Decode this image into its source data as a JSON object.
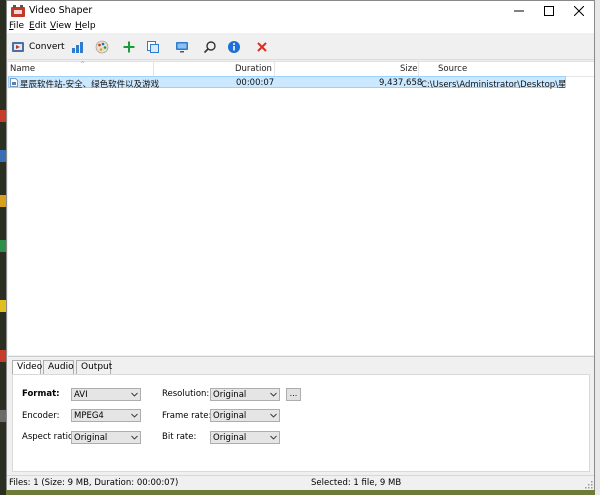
{
  "window": {
    "title": "Video Shaper",
    "controls": [
      "minimize",
      "maximize",
      "close"
    ]
  },
  "menu": {
    "items": [
      {
        "label": "File",
        "mnemonic": "F",
        "rest": "ile"
      },
      {
        "label": "Edit",
        "mnemonic": "E",
        "rest": "dit"
      },
      {
        "label": "View",
        "mnemonic": "V",
        "rest": "iew"
      },
      {
        "label": "Help",
        "mnemonic": "H",
        "rest": "elp"
      }
    ]
  },
  "toolbar": {
    "convert_label": "Convert",
    "icons": [
      "convert-icon",
      "chart-icon",
      "palette-icon",
      "add-icon",
      "copy-icon",
      "monitor-icon",
      "search-icon",
      "info-icon",
      "delete-icon"
    ],
    "colors": {
      "add": "#1a9c3a",
      "info": "#1e6fd9",
      "delete": "#d93025"
    }
  },
  "filelist": {
    "columns": [
      "Name",
      "Duration",
      "Size",
      "Source"
    ],
    "rows": [
      {
        "name": "星辰软件站-安全、绿色软件以及游戏...",
        "duration": "00:00:07",
        "size": "9,437,658",
        "source": "C:\\Users\\Administrator\\Desktop\\星..."
      }
    ],
    "selected_color": "#cce8ff"
  },
  "panel": {
    "tabs": [
      "Video",
      "Audio",
      "Output"
    ],
    "active_tab": "Video",
    "fields": {
      "format_label": "Format:",
      "format_value": "AVI",
      "encoder_label": "Encoder:",
      "encoder_value": "MPEG4",
      "aspect_label": "Aspect ratio:",
      "aspect_value": "Original",
      "resolution_label": "Resolution:",
      "resolution_value": "Original",
      "framerate_label": "Frame rate:",
      "framerate_value": "Original",
      "bitrate_label": "Bit rate:",
      "bitrate_value": "Original",
      "more_button": "..."
    }
  },
  "status": {
    "left": "Files: 1 (Size: 9 MB, Duration: 00:00:07)",
    "right": "Selected: 1 file, 9 MB"
  }
}
